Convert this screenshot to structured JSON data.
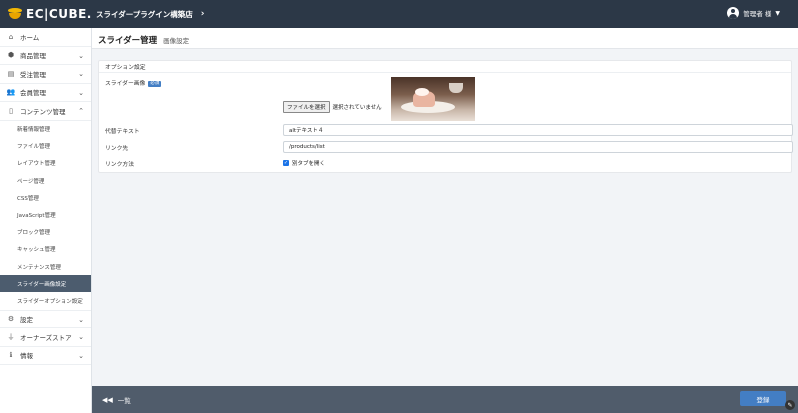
{
  "header": {
    "logo_text": "EC|CUBE.",
    "shop_name": "スライダープラグイン構築店",
    "shop_chevron": "›",
    "user_label": "管理者 様",
    "user_caret": "▼"
  },
  "sidebar": {
    "items": [
      {
        "label": "ホーム",
        "icon": "⌂"
      },
      {
        "label": "商品管理",
        "icon": "⬢",
        "chevron": "⌄"
      },
      {
        "label": "受注管理",
        "icon": "▤",
        "chevron": "⌄"
      },
      {
        "label": "会員管理",
        "icon": "👥",
        "chevron": "⌄"
      },
      {
        "label": "コンテンツ管理",
        "icon": "▯",
        "chevron": "⌃"
      }
    ],
    "content_sub": [
      "新着情報管理",
      "ファイル管理",
      "レイアウト管理",
      "ページ管理",
      "CSS管理",
      "JavaScript管理",
      "ブロック管理",
      "キャッシュ管理",
      "メンテナンス管理",
      "スライダー画像設定",
      "スライダーオプション設定"
    ],
    "bottom_items": [
      {
        "label": "設定",
        "icon": "⚙",
        "chevron": "⌄"
      },
      {
        "label": "オーナーズストア",
        "icon": "⏚",
        "chevron": "⌄"
      },
      {
        "label": "情報",
        "icon": "ℹ",
        "chevron": "⌄"
      }
    ]
  },
  "main": {
    "title": "スライダー管理",
    "subtitle": "画像設定",
    "card_title": "オプション設定",
    "image_label": "スライダー画像",
    "required_badge": "必須",
    "file_button": "ファイルを選択",
    "file_status": "選択されていません",
    "alt_label": "代替テキスト",
    "alt_value": "altテキスト４",
    "link_label": "リンク先",
    "link_value": "/products/list",
    "link_method_label": "リンク方法",
    "new_tab_label": "別タブを開く",
    "new_tab_checked": true
  },
  "footer": {
    "back_icon": "◀◀",
    "back_label": "一覧",
    "save_label": "登録"
  },
  "colors": {
    "header_bg": "#2c3847",
    "active_nav": "#4c5c6e",
    "primary": "#437ec4",
    "footer_bg": "#505c6b"
  }
}
